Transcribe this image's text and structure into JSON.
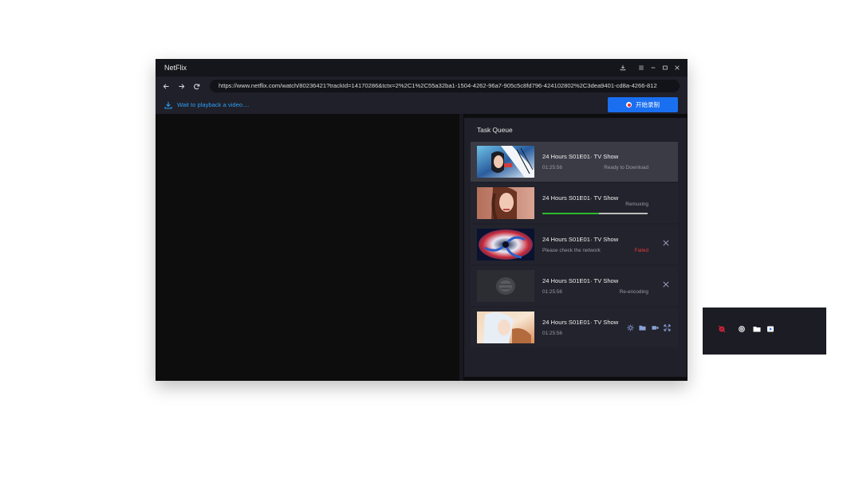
{
  "window": {
    "title": "NetFlix",
    "controls": [
      "download-icon",
      "menu-icon",
      "minimize-icon",
      "maximize-icon",
      "close-icon"
    ]
  },
  "nav": {
    "back_icon": "arrow-left-icon",
    "forward_icon": "arrow-right-icon",
    "refresh_icon": "refresh-icon",
    "url": "https://www.netflix.com/watch/80236421?trackId=14170286&tctx=2%2C1%2C55a32ba1-1504-4262-96a7-905c5c8fd796-424102802%2C3dea9401-cd8a-4266-812"
  },
  "toolbar": {
    "status_icon": "download-icon",
    "status_text": "Wait to playback a video....",
    "record_label": "开始录制",
    "record_color": "#1a6ff0"
  },
  "queue": {
    "title": "Task Queue",
    "tasks": [
      {
        "title": "24 Hours S01E01· TV Show",
        "sub": "01:25:56",
        "status": "Ready to Download",
        "state": "selected"
      },
      {
        "title": "24 Hours S01E01· TV Show",
        "sub": "",
        "status": "Remuxing",
        "progress": 0.54
      },
      {
        "title": "24 Hours S01E01· TV Show",
        "sub": "Please check the network",
        "status": "Failed",
        "status_color": "#e53935"
      },
      {
        "title": "24 Hours S01E01· TV Show",
        "sub": "01:25:56",
        "status": "Re-encoding"
      },
      {
        "title": "24 Hours S01E01· TV Show",
        "sub": "01:25:56",
        "status": "",
        "actions": [
          "gear-icon",
          "folder-icon",
          "video-icon",
          "expand-icon"
        ]
      }
    ]
  },
  "floating_toolbar": {
    "icons": [
      "record-icon",
      "gear-icon",
      "folder-icon",
      "play-icon"
    ]
  }
}
